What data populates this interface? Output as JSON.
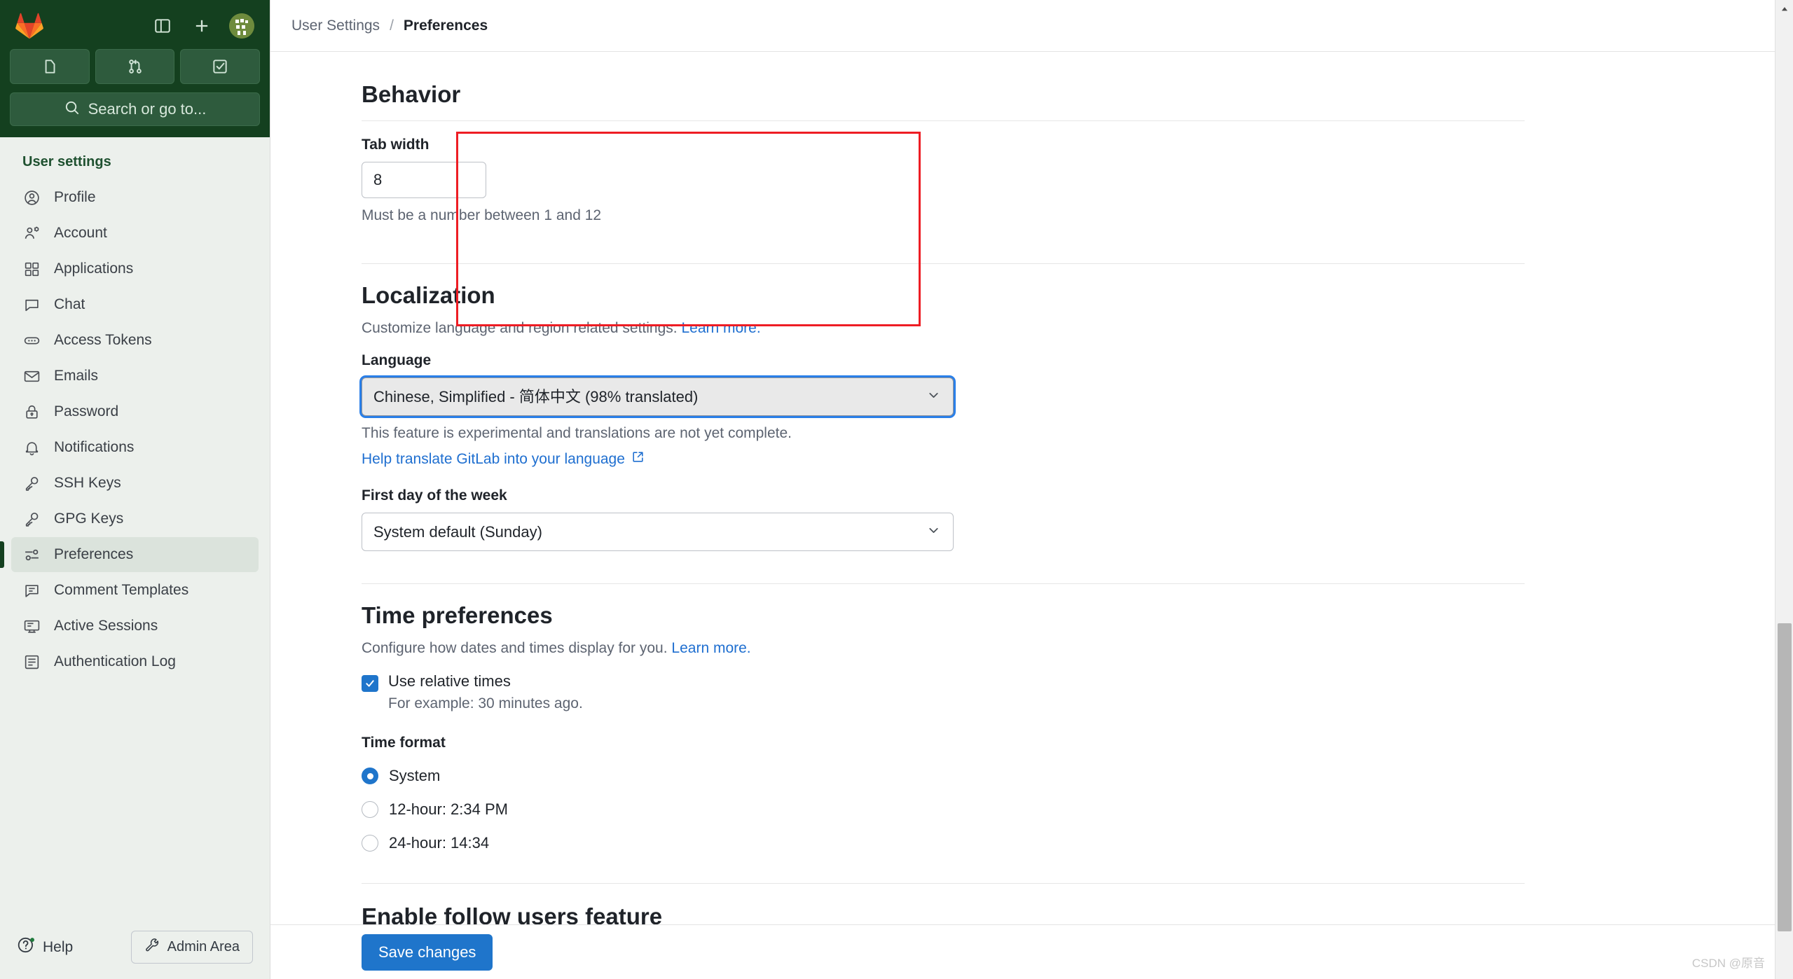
{
  "sidebar": {
    "logo_icon": "gitlab-logo-icon",
    "toggle_icon": "sidebar-toggle-icon",
    "plus_icon": "plus-icon",
    "avatar_icon": "user-avatar",
    "quick_tabs": [
      {
        "name": "issues",
        "icon": "issue-icon"
      },
      {
        "name": "merge-requests",
        "icon": "merge-request-icon"
      },
      {
        "name": "todos",
        "icon": "todo-checkbox-icon"
      }
    ],
    "search": {
      "label": "Search or go to...",
      "icon": "search-icon"
    },
    "section_heading": "User settings",
    "items": [
      {
        "label": "Profile",
        "icon": "user-circle-icon",
        "active": false
      },
      {
        "label": "Account",
        "icon": "account-gear-icon",
        "active": false
      },
      {
        "label": "Applications",
        "icon": "applications-grid-icon",
        "active": false
      },
      {
        "label": "Chat",
        "icon": "chat-bubble-icon",
        "active": false
      },
      {
        "label": "Access Tokens",
        "icon": "token-icon",
        "active": false
      },
      {
        "label": "Emails",
        "icon": "envelope-icon",
        "active": false
      },
      {
        "label": "Password",
        "icon": "lock-icon",
        "active": false
      },
      {
        "label": "Notifications",
        "icon": "bell-icon",
        "active": false
      },
      {
        "label": "SSH Keys",
        "icon": "key-icon",
        "active": false
      },
      {
        "label": "GPG Keys",
        "icon": "key-icon",
        "active": false
      },
      {
        "label": "Preferences",
        "icon": "sliders-icon",
        "active": true
      },
      {
        "label": "Comment Templates",
        "icon": "comment-lines-icon",
        "active": false
      },
      {
        "label": "Active Sessions",
        "icon": "monitor-icon",
        "active": false
      },
      {
        "label": "Authentication Log",
        "icon": "log-list-icon",
        "active": false
      }
    ],
    "footer": {
      "help_label": "Help",
      "help_icon": "question-circle-icon",
      "admin_label": "Admin Area",
      "admin_icon": "wrench-icon"
    }
  },
  "breadcrumb": {
    "parent": "User Settings",
    "separator": "/",
    "current": "Preferences"
  },
  "behavior": {
    "title": "Behavior",
    "tab_width_label": "Tab width",
    "tab_width_value": "8",
    "tab_width_help": "Must be a number between 1 and 12"
  },
  "localization": {
    "title": "Localization",
    "description": "Customize language and region related settings.",
    "learn_more": "Learn more.",
    "language_label": "Language",
    "language_value": "Chinese, Simplified - 简体中文 (98% translated)",
    "language_note": "This feature is experimental and translations are not yet complete.",
    "translate_link": "Help translate GitLab into your language",
    "external_link_icon": "external-link-icon",
    "first_day_label": "First day of the week",
    "first_day_value": "System default (Sunday)",
    "chevron_icon": "chevron-down-icon"
  },
  "time_preferences": {
    "title": "Time preferences",
    "description": "Configure how dates and times display for you.",
    "learn_more": "Learn more.",
    "relative_times_label": "Use relative times",
    "relative_times_checked": true,
    "relative_times_example": "For example: 30 minutes ago.",
    "time_format_label": "Time format",
    "options": [
      {
        "label": "System",
        "selected": true
      },
      {
        "label": "12-hour: 2:34 PM",
        "selected": false
      },
      {
        "label": "24-hour: 14:34",
        "selected": false
      }
    ]
  },
  "follow_section": {
    "title": "Enable follow users feature"
  },
  "save_bar": {
    "save_label": "Save changes"
  },
  "watermark": {
    "text": "CSDN @原音"
  },
  "colors": {
    "brand_dark_green": "#14401f",
    "sidebar_bg": "#ecf0ec",
    "accent_blue": "#1f75cb",
    "link_blue": "#1f6fd0",
    "annotation_red": "#ee1d24"
  }
}
